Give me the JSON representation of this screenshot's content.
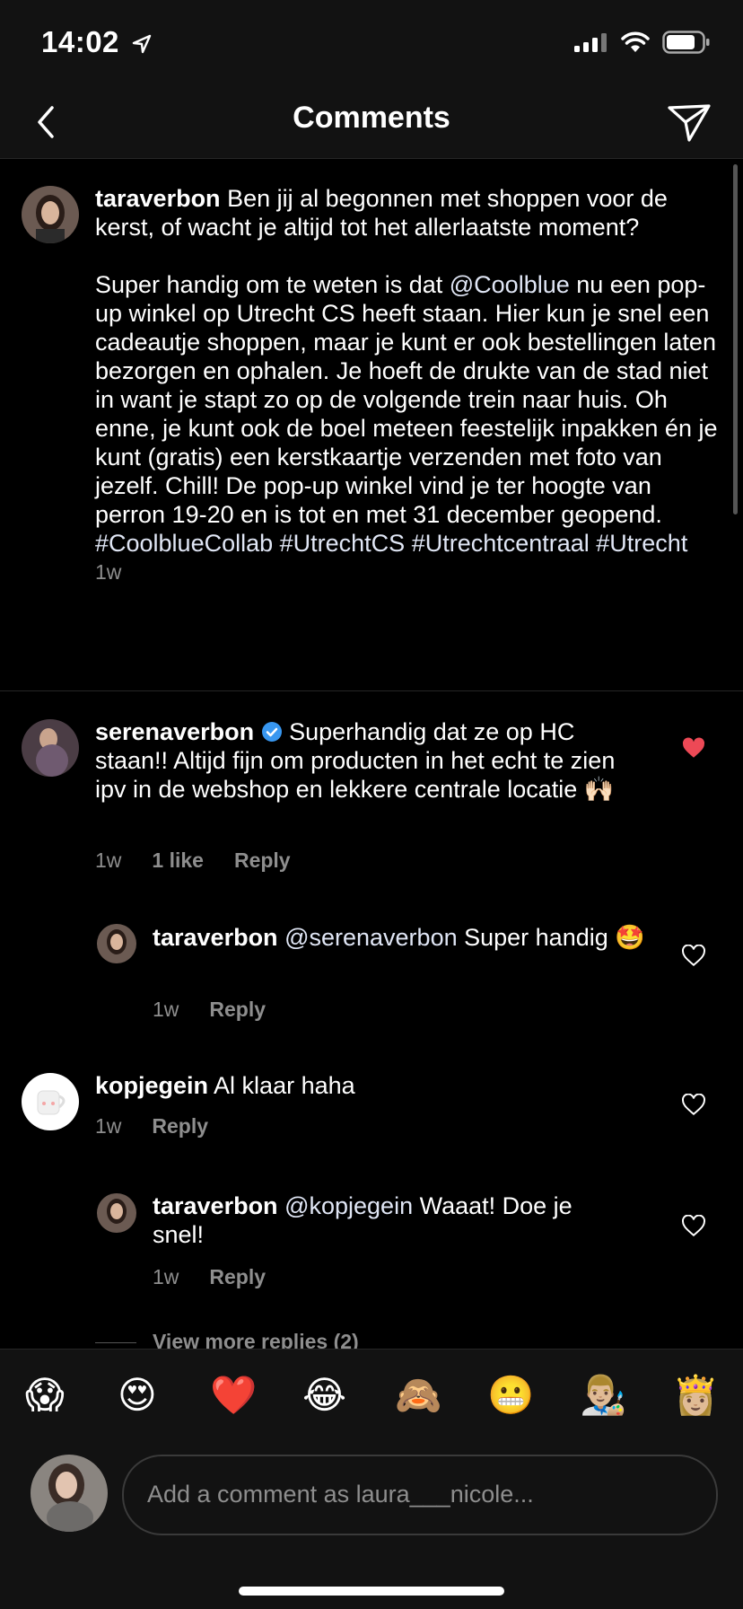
{
  "status": {
    "time": "14:02"
  },
  "nav": {
    "title": "Comments"
  },
  "caption": {
    "username": "taraverbon",
    "text_plain_1": " Ben jij al begonnen met shoppen voor de kerst, of wacht je altijd tot het allerlaatste moment?\n\nSuper handig om te weten is dat ",
    "mention": "@Coolblue",
    "text_plain_2": " nu een pop-up winkel op Utrecht CS heeft staan. Hier kun je snel een cadeautje shoppen, maar je kunt er ook bestellingen laten bezorgen en ophalen. Je hoeft de drukte van de stad niet in want je stapt zo op de volgende trein naar huis. Oh enne, je kunt ook de boel meteen feestelijk inpakken én je kunt (gratis) een kerstkaartje verzenden met foto van jezelf. Chill! De pop-up winkel vind je ter hoogte van perron 19-20 en is tot en met 31 december geopend. ",
    "hashtags": "#CoolblueCollab #UtrechtCS #Utrechtcentraal #Utrecht",
    "time": "1w"
  },
  "comments": [
    {
      "username": "serenaverbon",
      "verified": true,
      "text": " Superhandig dat ze op HC staan!! Altijd fijn om producten in het echt te zien ipv in de webshop en lekkere centrale locatie 🙌🏻",
      "time": "1w",
      "likes": "1 like",
      "reply": "Reply",
      "liked": true
    },
    {
      "username": "taraverbon",
      "mention": "@serenaverbon",
      "text": " Super handig 🤩",
      "time": "1w",
      "reply": "Reply",
      "liked": false
    },
    {
      "username": "kopjegein",
      "text": " Al klaar haha",
      "time": "1w",
      "reply": "Reply",
      "liked": false
    },
    {
      "username": "taraverbon",
      "mention": "@kopjegein",
      "text": " Waaat! Doe je snel!",
      "time": "1w",
      "reply": "Reply",
      "liked": false
    }
  ],
  "view_more": "View more replies (2)",
  "emoji_bar": [
    "😱",
    "😍",
    "❤️",
    "😂",
    "🙈",
    "😬",
    "👨🏼‍🎨",
    "👸🏼"
  ],
  "input": {
    "placeholder": "Add a comment as laura___nicole..."
  },
  "colors": {
    "background": "#000000",
    "bar": "#121212",
    "muted": "#8e8e8e",
    "liked_heart": "#ed4956"
  }
}
